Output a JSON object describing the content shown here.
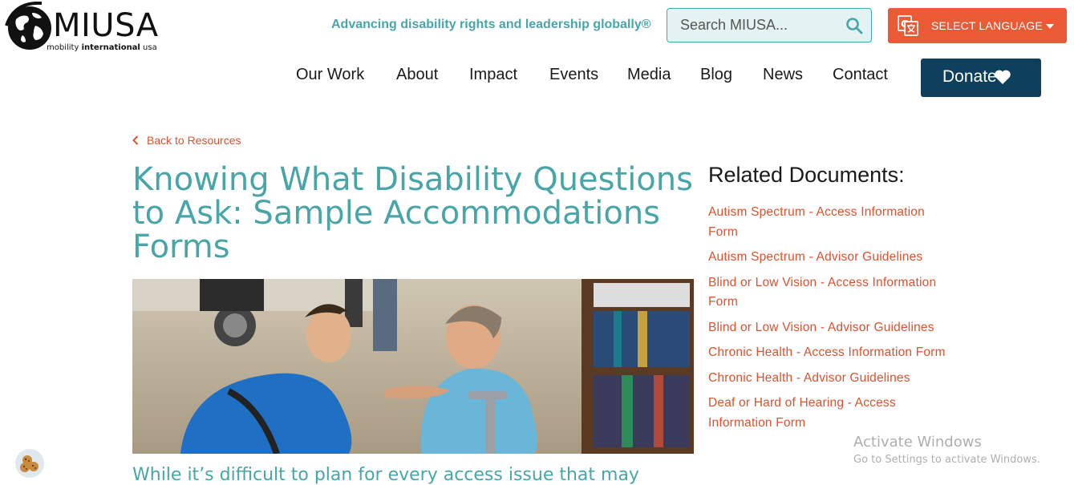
{
  "header": {
    "logo_text": "MIUSA",
    "logo_sub_1": "mobility",
    "logo_sub_2": "international",
    "logo_sub_3": "usa",
    "tagline": "Advancing disability rights and leadership globally®",
    "search_placeholder": "Search MIUSA...",
    "language_label": "SELECT LANGUAGE",
    "donate_label": "Donate"
  },
  "nav": {
    "items": [
      "Our Work",
      "About",
      "Impact",
      "Events",
      "Media",
      "Blog",
      "News",
      "Contact"
    ]
  },
  "article": {
    "back_label": "Back to Resources",
    "title": "Knowing What Disability Questions to Ask: Sample Accommodations Forms",
    "intro": "While it’s difficult to plan for every access issue that may"
  },
  "related": {
    "heading": "Related Documents:",
    "items": [
      "Autism Spectrum - Access Information Form",
      "Autism Spectrum - Advisor Guidelines",
      "Blind or Low Vision - Access Information Form",
      "Blind or Low Vision - Advisor Guidelines",
      "Chronic Health - Access Information Form",
      "Chronic Health - Advisor Guidelines",
      "Deaf or Hard of Hearing - Access Information Form"
    ]
  },
  "watermark": {
    "line1": "Activate Windows",
    "line2": "Go to Settings to activate Windows."
  },
  "colors": {
    "teal": "#4aa5a8",
    "orange": "#ea5a34",
    "link_red": "#d9532f",
    "navy": "#0e3f5c"
  },
  "icons": [
    "globe-logo-icon",
    "search-icon",
    "translate-icon",
    "caret-down-icon",
    "heart-icon",
    "chevron-left-icon",
    "cookie-icon"
  ]
}
